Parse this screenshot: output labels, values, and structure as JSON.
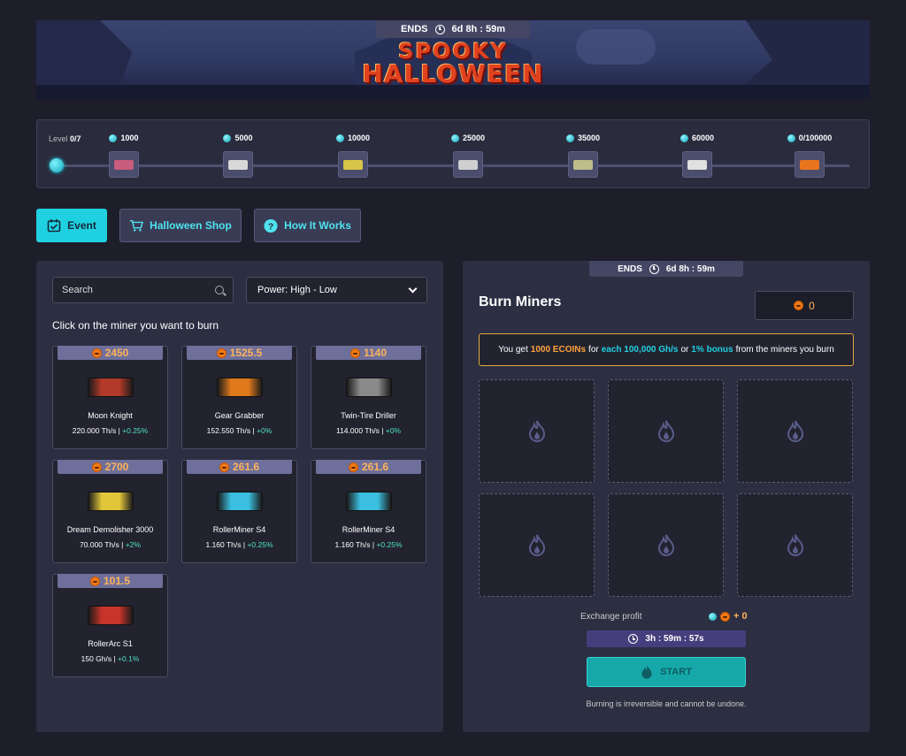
{
  "banner": {
    "title_line1": "SPOOKY",
    "title_line2": "HALLOWEEN",
    "ends_label": "ENDS",
    "ends_time": "6d 8h : 59m"
  },
  "progress": {
    "level_label": "Level",
    "level_value": "0/7",
    "milestones": [
      {
        "amount": "1000",
        "color": "#c95d7d"
      },
      {
        "amount": "5000",
        "color": "#d8d8d8"
      },
      {
        "amount": "10000",
        "color": "#d8c548"
      },
      {
        "amount": "25000",
        "color": "#cfcfcf"
      },
      {
        "amount": "35000",
        "color": "#bdbd8a"
      },
      {
        "amount": "60000",
        "color": "#e0e0e0"
      },
      {
        "amount": "0/100000",
        "color": "#e8741c"
      }
    ]
  },
  "tabs": [
    {
      "label": "Event",
      "icon": "calendar-check-icon"
    },
    {
      "label": "Halloween Shop",
      "icon": "cart-icon"
    },
    {
      "label": "How It Works",
      "icon": "question-icon"
    }
  ],
  "filters": {
    "search_placeholder": "Search",
    "sort_value": "Power: High - Low"
  },
  "instruction": "Click on the miner you want to burn",
  "miners": [
    {
      "price": "2450",
      "name": "Moon Knight",
      "power": "220.000 Th/s",
      "bonus": "+0.25%",
      "color": "#b33a2a"
    },
    {
      "price": "1525.5",
      "name": "Gear Grabber",
      "power": "152.550 Th/s",
      "bonus": "+0%",
      "color": "#e0791c"
    },
    {
      "price": "1140",
      "name": "Twin-Tire Driller",
      "power": "114.000 Th/s",
      "bonus": "+0%",
      "color": "#8a8a8a"
    },
    {
      "price": "2700",
      "name": "Dream Demolisher 3000",
      "power": "70.000 Th/s",
      "bonus": "+2%",
      "color": "#e2c63a"
    },
    {
      "price": "261.6",
      "name": "RollerMiner S4",
      "power": "1.160 Th/s",
      "bonus": "+0.25%",
      "color": "#3bbfe0"
    },
    {
      "price": "261.6",
      "name": "RollerMiner S4",
      "power": "1.160 Th/s",
      "bonus": "+0.25%",
      "color": "#3bbfe0"
    },
    {
      "price": "101.5",
      "name": "RollerArc S1",
      "power": "150 Gh/s",
      "bonus": "+0.1%",
      "color": "#c8342a"
    }
  ],
  "burn": {
    "ends_label": "ENDS",
    "ends_time": "6d 8h : 59m",
    "title": "Burn Miners",
    "counter": "0",
    "info_prefix": "You get",
    "info_amount": "1000 ECOINs",
    "info_for": "for",
    "info_rate": "each 100,000 Gh/s",
    "info_or": "or",
    "info_bonus": "1% bonus",
    "info_suffix": "from the miners you burn",
    "exchange_label": "Exchange profit",
    "exchange_value": "+ 0",
    "timer": "3h : 59m : 57s",
    "start_label": "START",
    "warning": "Burning is irreversible and cannot be undone."
  }
}
